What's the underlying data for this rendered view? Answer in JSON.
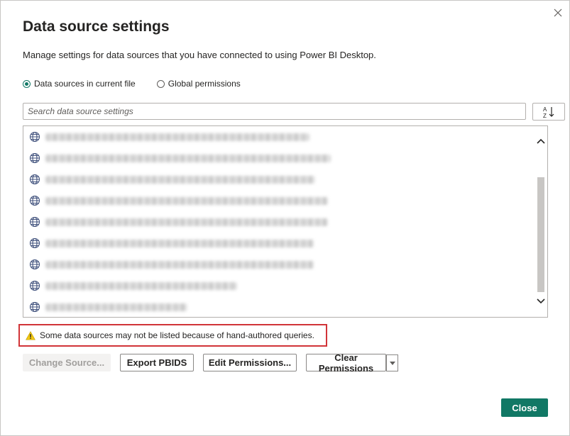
{
  "dialog": {
    "title": "Data source settings",
    "subtitle": "Manage settings for data sources that you have connected to using Power BI Desktop.",
    "close_icon": "close-icon"
  },
  "scope": {
    "options": [
      {
        "label": "Data sources in current file",
        "checked": true
      },
      {
        "label": "Global permissions",
        "checked": false
      }
    ]
  },
  "search": {
    "placeholder": "Search data source settings",
    "value": "",
    "sort_icon": "sort-az-icon"
  },
  "sources": {
    "icon": "globe-icon",
    "items": [
      {
        "url": "https://"
      },
      {
        "url": "https://"
      },
      {
        "url": "https://"
      },
      {
        "url": "https://"
      },
      {
        "url": "https://"
      },
      {
        "url": "https://"
      },
      {
        "url": "https://"
      },
      {
        "url": "https://"
      },
      {
        "url": "https://"
      }
    ]
  },
  "warning": {
    "text": "Some data sources may not be listed because of hand-authored queries.",
    "icon": "warning-icon",
    "color": "#d13438"
  },
  "actions": {
    "change_source": "Change Source...",
    "export_pbids": "Export PBIDS",
    "edit_permissions": "Edit Permissions...",
    "clear_permissions": "Clear Permissions",
    "close": "Close"
  },
  "colors": {
    "accent": "#117865",
    "warning_border": "#d13438"
  }
}
